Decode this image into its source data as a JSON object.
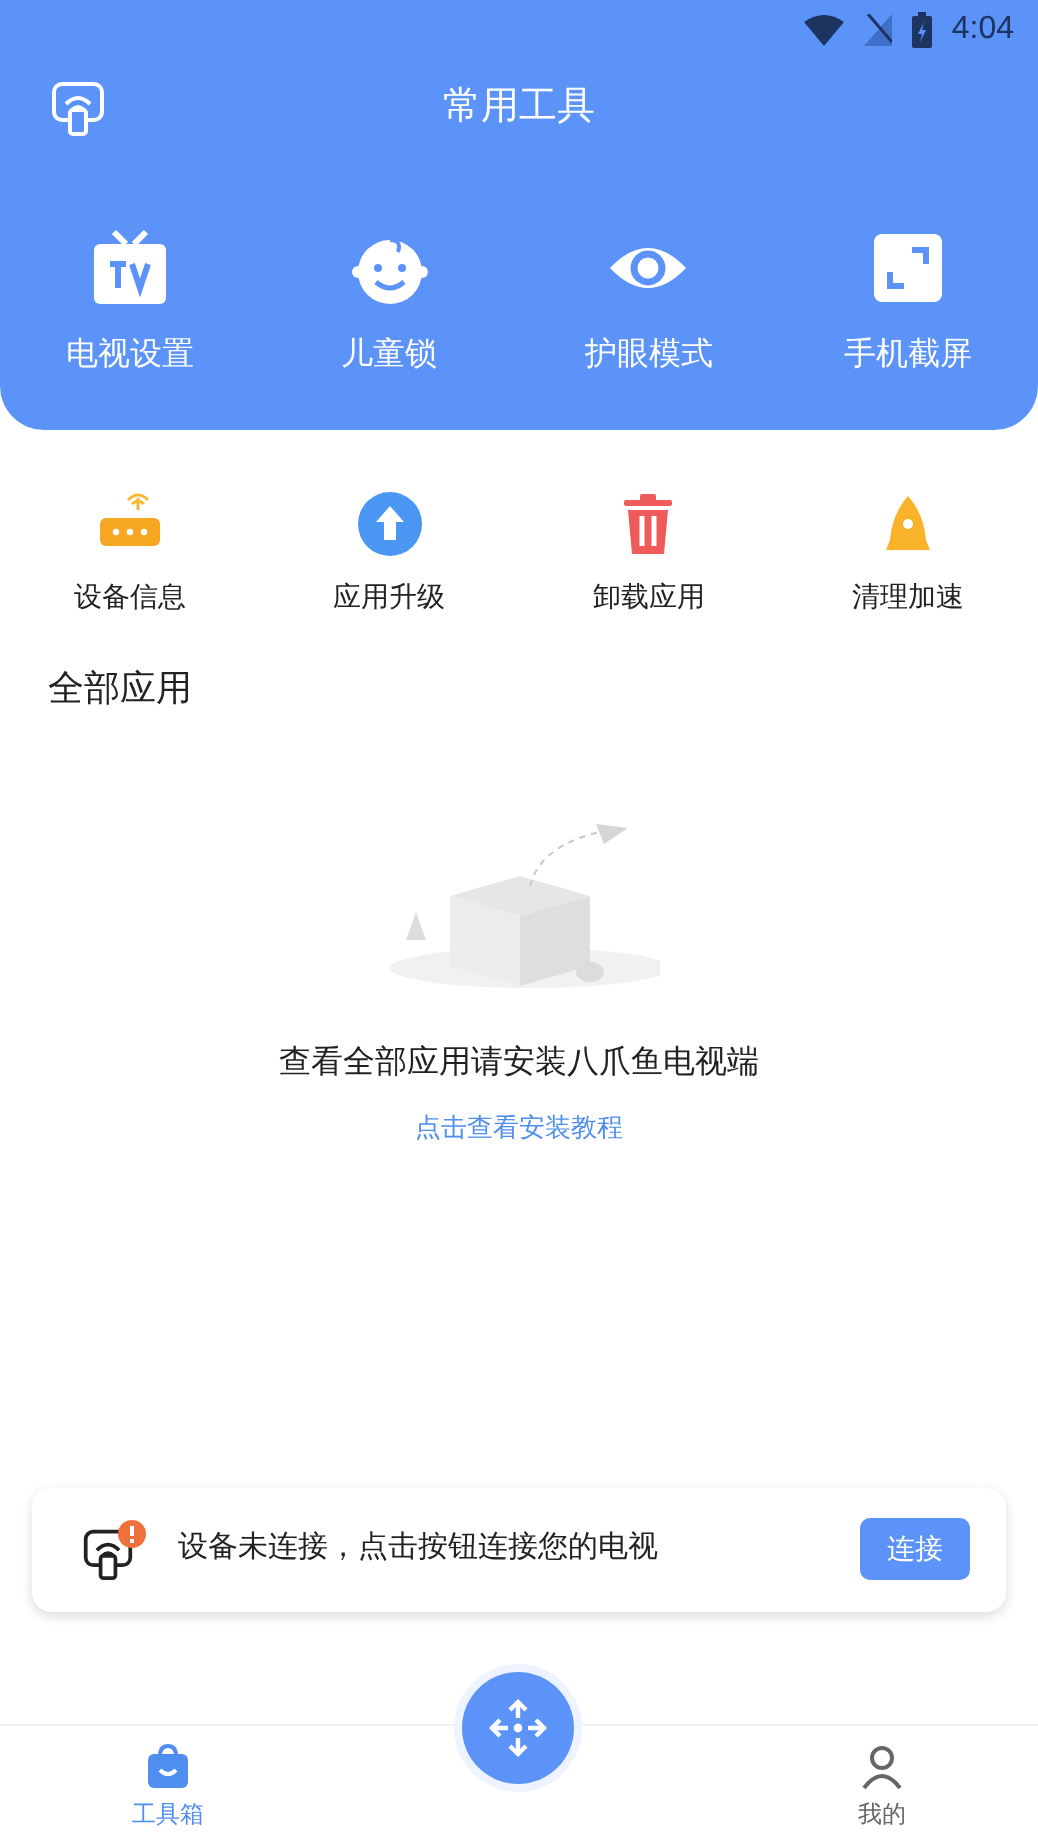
{
  "status_bar": {
    "time": "4:04"
  },
  "header": {
    "title": "常用工具"
  },
  "main_tools": [
    {
      "kind": "tv",
      "label": "电视设置"
    },
    {
      "kind": "child",
      "label": "儿童锁"
    },
    {
      "kind": "eye",
      "label": "护眼模式"
    },
    {
      "kind": "screenshot",
      "label": "手机截屏"
    }
  ],
  "sub_tools": [
    {
      "kind": "router",
      "label": "设备信息"
    },
    {
      "kind": "upgrade",
      "label": "应用升级"
    },
    {
      "kind": "trash",
      "label": "卸载应用"
    },
    {
      "kind": "rocket",
      "label": "清理加速"
    }
  ],
  "section_title": "全部应用",
  "empty_state": {
    "message": "查看全部应用请安装八爪鱼电视端",
    "link": "点击查看安装教程"
  },
  "connect_card": {
    "message": "设备未连接，点击按钮连接您的电视",
    "button": "连接",
    "alert": true
  },
  "bottom_nav": [
    {
      "kind": "toolbox",
      "label": "工具箱",
      "selected": true
    },
    {
      "kind": "profile",
      "label": "我的",
      "selected": false
    }
  ]
}
